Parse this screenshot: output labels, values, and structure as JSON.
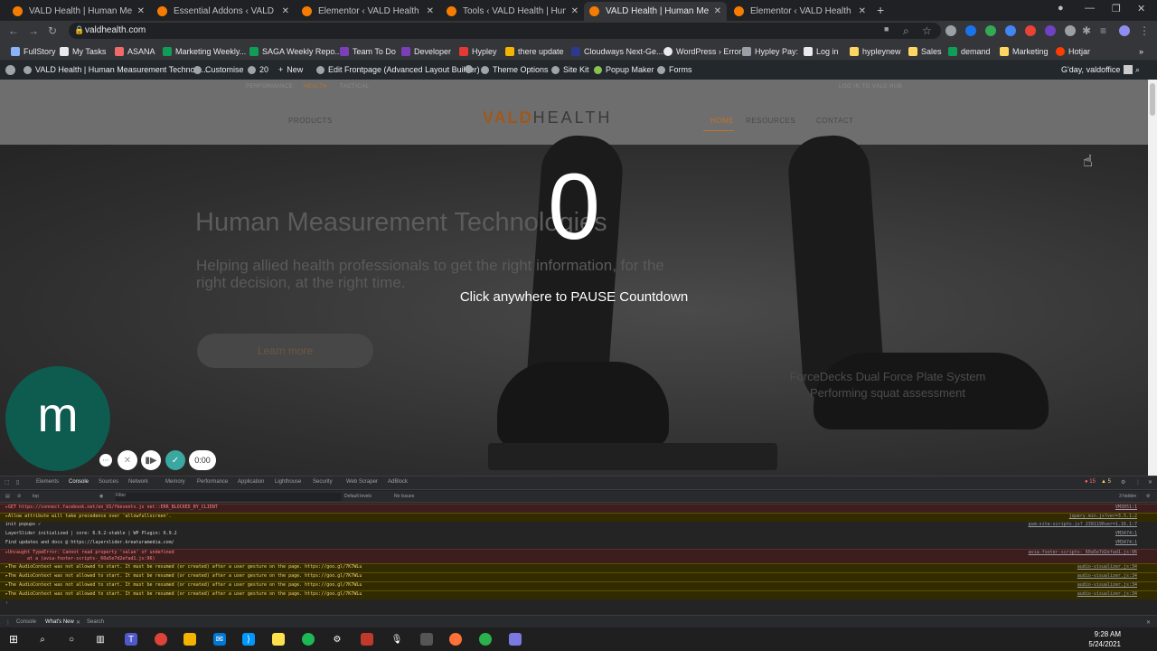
{
  "browser": {
    "tabs": [
      {
        "title": "VALD Health | Human Measurem...",
        "active": false
      },
      {
        "title": "Essential Addons ‹ VALD Health |...",
        "active": false
      },
      {
        "title": "Elementor ‹ VALD Health | Huma...",
        "active": false
      },
      {
        "title": "Tools ‹ VALD Health | Human Me...",
        "active": false
      },
      {
        "title": "VALD Health | Human Measurem...",
        "active": true
      },
      {
        "title": "Elementor ‹ VALD Health | Huma...",
        "active": false
      }
    ],
    "url": "valdhealth.com",
    "bookmarks": [
      "FullStory",
      "My Tasks",
      "ASANA",
      "Marketing Weekly...",
      "SAGA Weekly Repo...",
      "Team To Do",
      "Developer",
      "Hypley",
      "there update",
      "Cloudways Next-Ge...",
      "WordPress › Error",
      "Hypley Pay:",
      "Log in",
      "hypleynew",
      "Sales",
      "demand",
      "Marketing",
      "Hotjar"
    ]
  },
  "wp_admin_bar": {
    "site_name": "VALD Health | Human Measurement Technolo...",
    "customise": "Customise",
    "updates": "20",
    "new": "New",
    "edit": "Edit Frontpage (Advanced Layout Builder)",
    "theme_options": "Theme Options",
    "site_kit": "Site Kit",
    "popup_maker": "Popup Maker",
    "forms": "Forms",
    "greeting": "G'day, valdoffice"
  },
  "site": {
    "top_links": [
      "PERFORMANCE",
      "HEALTH",
      "TACTICAL"
    ],
    "login_link": "LOG IN TO VALD HUB",
    "nav": {
      "products": "PRODUCTS",
      "home": "HOME",
      "resources": "RESOURCES",
      "contact": "CONTACT"
    },
    "logo_vald": "VALD",
    "logo_health": "HEALTH",
    "hero_title": "Human Measurement Technologies",
    "hero_subtitle": "Helping allied health professionals to get the right information, for the right decision, at the right time.",
    "learn_more": "Learn more",
    "ghost_caption": "ForceDecks Dual Force Plate System Performing squat assessment",
    "countdown_value": "0",
    "countdown_hint": "Click anywhere to PAUSE Countdown"
  },
  "recorder": {
    "avatar_letter": "m",
    "timer": "0:00"
  },
  "devtools": {
    "tabs": [
      "Elements",
      "Console",
      "Sources",
      "Network",
      "Memory",
      "Performance",
      "Application",
      "Lighthouse",
      "Security",
      "Web Scraper",
      "AdBlock"
    ],
    "active_tab": "Console",
    "error_count": "15",
    "warning_count": "5",
    "context": "top",
    "filter_placeholder": "Filter",
    "levels": "Default levels",
    "no_issues": "No Issues",
    "hidden": "3 hidden",
    "logs": [
      {
        "level": "err",
        "text": "▸GET https://connect.facebook.net/en_US/fbevents.js net::ERR_BLOCKED_BY_CLIENT",
        "src": "VM3051:1"
      },
      {
        "level": "warn",
        "text": "▸Allow attribute will take precedence over 'allowfullscreen'.",
        "src": "jquery.min.js?ver=3.5.1:2"
      },
      {
        "level": "info",
        "text": "init popups ✓",
        "src": "pum-site-scripts.js?_2381196ver=1.16.1:7"
      },
      {
        "level": "info",
        "text": "LayerSlider initialized | core: 6.9.2-stable | WP Plugin: 6.9.2",
        "src": "VM3474:1"
      },
      {
        "level": "info",
        "text": "Find updates and docs @ https://layerslider.kreaturamedia.com/",
        "src": "VM3474:1"
      },
      {
        "level": "err",
        "text": "▸Uncaught TypeError: Cannot read property 'value' of undefined",
        "text2": "at a (avia-footer-scripts-_60a5e7d2efad1.js:96)",
        "src": "avia-footer-scripts-_60a5e7d2efad1.js:96"
      },
      {
        "level": "warn",
        "text": "▸The AudioContext was not allowed to start. It must be resumed (or created) after a user gesture on the page. https://goo.gl/7K7WLu",
        "src": "audio-visualizer.js:34"
      },
      {
        "level": "warn",
        "text": "▸The AudioContext was not allowed to start. It must be resumed (or created) after a user gesture on the page. https://goo.gl/7K7WLu",
        "src": "audio-visualizer.js:34"
      },
      {
        "level": "warn",
        "text": "▸The AudioContext was not allowed to start. It must be resumed (or created) after a user gesture on the page. https://goo.gl/7K7WLu",
        "src": "audio-visualizer.js:34"
      },
      {
        "level": "warn",
        "text": "▸The AudioContext was not allowed to start. It must be resumed (or created) after a user gesture on the page. https://goo.gl/7K7WLu",
        "src": "audio-visualizer.js:34"
      }
    ],
    "bottom_tabs": [
      "Console",
      "What's New",
      "Search"
    ]
  },
  "taskbar": {
    "time": "9:28 AM",
    "date": "5/24/2021"
  }
}
